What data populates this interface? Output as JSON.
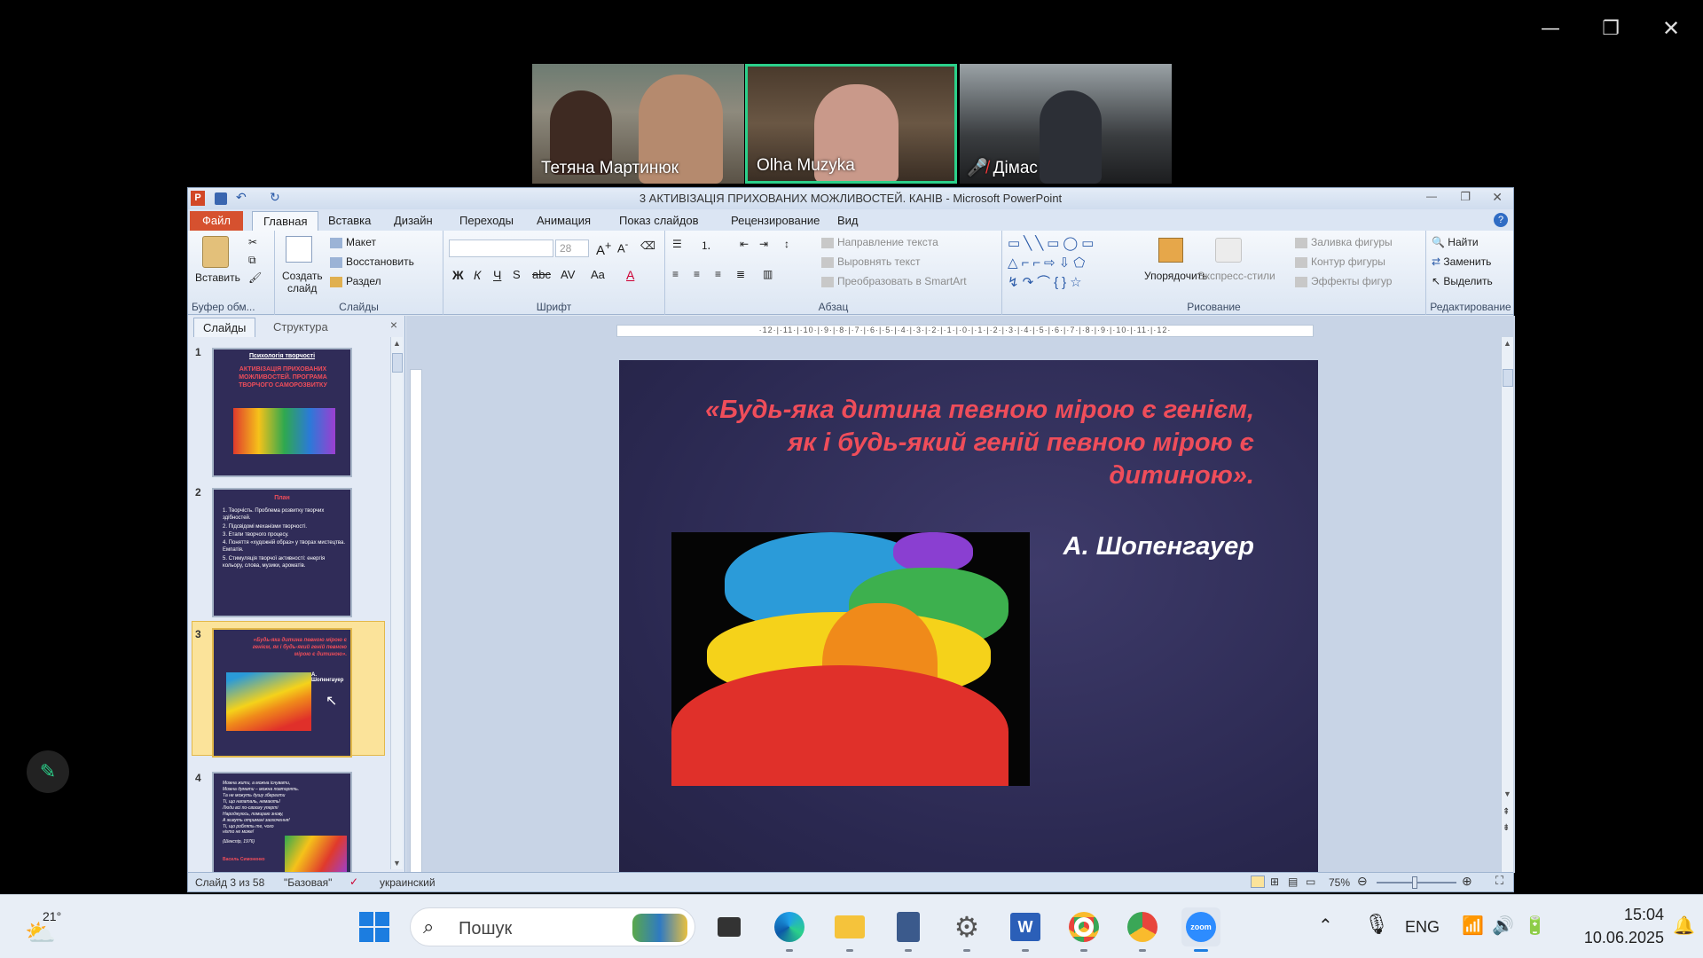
{
  "window_controls": {
    "minimize": "—",
    "restore": "❐",
    "close": "✕"
  },
  "participants": [
    {
      "name": "Тетяна Мартинюк",
      "muted": false
    },
    {
      "name": "Olha Muzyka",
      "muted": false,
      "active_speaker": true
    },
    {
      "name": "Дімас",
      "muted": true
    }
  ],
  "ppt": {
    "title": "3 АКТИВІЗАЦІЯ ПРИХОВАНИХ МОЖЛИВОСТЕЙ. КАНІВ  -  Microsoft PowerPoint",
    "tabs": [
      "Файл",
      "Главная",
      "Вставка",
      "Дизайн",
      "Переходы",
      "Анимация",
      "Показ слайдов",
      "Рецензирование",
      "Вид"
    ],
    "ribbon": {
      "clipboard": {
        "paste": "Вставить",
        "label": "Буфер обм..."
      },
      "slides": {
        "new_slide_1": "Создать",
        "new_slide_2": "слайд",
        "layout": "Макет",
        "reset": "Восстановить",
        "section": "Раздел",
        "label": "Слайды"
      },
      "font": {
        "font_size": "28",
        "label": "Шрифт"
      },
      "paragraph": {
        "text_direction": "Направление текста",
        "align_text": "Выровнять текст",
        "smartart": "Преобразовать в SmartArt",
        "label": "Абзац"
      },
      "drawing": {
        "arrange": "Упорядочить",
        "quick_styles": "Экспресс-стили",
        "fill": "Заливка фигуры",
        "outline": "Контур фигуры",
        "effects": "Эффекты фигур",
        "label": "Рисование"
      },
      "editing": {
        "find": "Найти",
        "replace": "Заменить",
        "select": "Выделить",
        "label": "Редактирование"
      }
    },
    "pane_tabs": {
      "slides": "Слайды",
      "outline": "Структура"
    },
    "thumbnails": [
      {
        "num": "1",
        "header": "Психологія творчості",
        "title": "АКТИВІЗАЦІЯ ПРИХОВАНИХ МОЖЛИВОСТЕЙ. ПРОГРАМА ТВОРЧОГО САМОРОЗВИТКУ"
      },
      {
        "num": "2",
        "header": "План",
        "lines": [
          "1. Творчість. Проблема розвитку творчих здібностей.",
          "2. Підсвідомі механізми творчості.",
          "3. Етапи творчого процесу.",
          "4. Поняття «художній образ» у творах мистецтва. Емпатія.",
          "5. Стимуляція творчої активності: енергія кольору, слова, музики, ароматів."
        ]
      },
      {
        "num": "3",
        "quote": "«Будь-яка дитина певною мірою є генієм, як і будь-який геній певною мірою є дитиною».",
        "author": "А. Шопенгауер"
      },
      {
        "num": "4",
        "lines": [
          "Можна жити, а можна існувати,",
          "Можна думати – можна повторять.",
          "Та не можуть душу зберегти",
          "Ті, що напаталь, немають!",
          "Люди всі по-своєму уперті",
          "Народжуюсь, помираю знову,",
          "А живуть отримані заохочення!",
          "Ті, що роблять те, чого ніхто не може!",
          "(Шекспір, 1976)",
          "Василь Симоненко"
        ]
      }
    ],
    "slide": {
      "quote": "«Будь-яка дитина певною мірою є генієм, як і будь-який геній певною мірою є дитиною».",
      "author": "А. Шопенгауер"
    },
    "status": {
      "slide_info": "Слайд 3 из 58",
      "theme": "\"Базовая\"",
      "language": "украинский",
      "zoom": "75%"
    }
  },
  "taskbar": {
    "weather_temp": "21°",
    "search_placeholder": "Пошук",
    "language": "ENG",
    "time": "15:04",
    "date": "10.06.2025"
  },
  "colors": {
    "accent_quote": "#ef4d5a",
    "slide_bg": "#2c2a52",
    "active_speaker_border": "#2bd08a"
  }
}
